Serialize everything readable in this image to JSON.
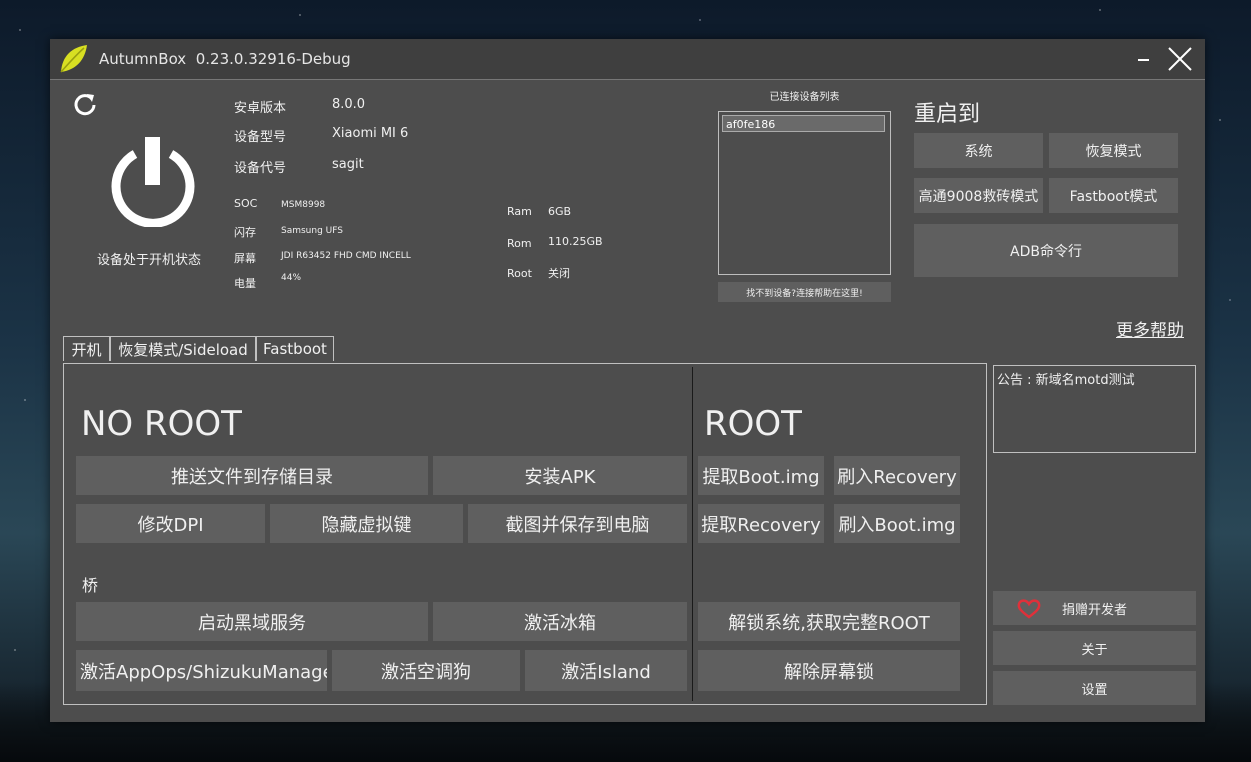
{
  "window": {
    "title": "AutumnBox",
    "version": "0.23.0.32916-Debug"
  },
  "device": {
    "status_text": "设备处于开机状态",
    "android_version_label": "安卓版本",
    "android_version": "8.0.0",
    "model_label": "设备型号",
    "model": "Xiaomi MI 6",
    "codename_label": "设备代号",
    "codename": "sagit",
    "soc_label": "SOC",
    "soc": "MSM8998",
    "flash_label": "闪存",
    "flash": "Samsung UFS",
    "screen_label": "屏幕",
    "screen": "JDI R63452 FHD CMD INCELL",
    "battery_label": "电量",
    "battery": "44%",
    "ram_label": "Ram",
    "ram": "6GB",
    "rom_label": "Rom",
    "rom": "110.25GB",
    "root_label": "Root",
    "root": "关闭"
  },
  "device_list": {
    "title": "已连接设备列表",
    "items": [
      "af0fe186"
    ],
    "help": "找不到设备?连接帮助在这里!"
  },
  "reboot": {
    "title": "重启到",
    "system": "系统",
    "recovery": "恢复模式",
    "qualcomm9008": "高通9008救砖模式",
    "fastboot": "Fastboot模式",
    "adb_cmd": "ADB命令行"
  },
  "more_help": "更多帮助",
  "tabs": [
    "开机",
    "恢复模式/Sideload",
    "Fastboot"
  ],
  "noroot": {
    "title": "NO ROOT",
    "push_file": "推送文件到存储目录",
    "install_apk": "安装APK",
    "modify_dpi": "修改DPI",
    "hide_vkeys": "隐藏虚拟键",
    "screenshot": "截图并保存到电脑",
    "bridge_label": "桥",
    "blackhole": "启动黑域服务",
    "icebox": "激活冰箱",
    "appops": "激活AppOps/ShizukuManager",
    "aircon": "激活空调狗",
    "island": "激活Island"
  },
  "root": {
    "title": "ROOT",
    "extract_boot": "提取Boot.img",
    "flash_recovery": "刷入Recovery",
    "extract_recovery": "提取Recovery",
    "flash_boot": "刷入Boot.img",
    "unlock_root": "解锁系统,获取完整ROOT",
    "remove_lock": "解除屏幕锁"
  },
  "motd": "公告 : 新域名motd测试",
  "sidebar": {
    "donate": "捐赠开发者",
    "about": "关于",
    "settings": "设置"
  },
  "colors": {
    "window_bg": "#4d4d4d",
    "button_bg": "#5f5f5f",
    "leaf": "#d8df22",
    "heart": "#e0303a"
  }
}
